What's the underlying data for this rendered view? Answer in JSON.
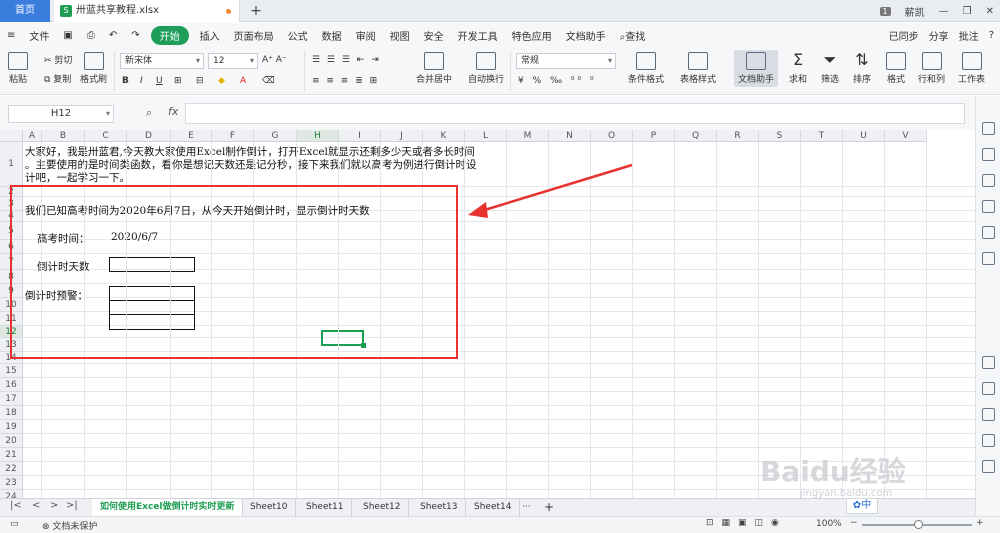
{
  "tabs": {
    "home": "首页",
    "file": "卅蓝共享教程.xlsx",
    "new": "+"
  },
  "window": {
    "badge": "1",
    "user": "薪凯"
  },
  "menu": {
    "file": "文件",
    "items": [
      "开始",
      "插入",
      "页面布局",
      "公式",
      "数据",
      "审阅",
      "视图",
      "安全",
      "开发工具",
      "特色应用",
      "文档助手"
    ],
    "search": "查找",
    "right": [
      "已同步",
      "分享",
      "批注",
      "?"
    ]
  },
  "ribbon": {
    "paste": "粘贴",
    "cut": "剪切",
    "copy": "复制",
    "format_painter": "格式刷",
    "font_name": "新宋体",
    "font_size": "12",
    "merge": "合并居中",
    "wrap": "自动换行",
    "number_format": "常规",
    "cond_format": "条件格式",
    "table_style": "表格样式",
    "doc_assist": "文档助手",
    "sum": "求和",
    "filter": "筛选",
    "sort": "排序",
    "format": "格式",
    "rowcol": "行和列",
    "worksheet": "工作表"
  },
  "formula_bar": {
    "name_box": "H12",
    "fx": "fx",
    "value": ""
  },
  "columns": [
    "A",
    "B",
    "C",
    "D",
    "E",
    "F",
    "G",
    "H",
    "I",
    "J",
    "K",
    "L",
    "M",
    "N",
    "O",
    "P",
    "Q",
    "R",
    "S",
    "T",
    "U",
    "V"
  ],
  "selected_column": "H",
  "rows": [
    "1",
    "2",
    "3",
    "4",
    "5",
    "6",
    "7",
    "8",
    "9",
    "10",
    "11",
    "12",
    "13",
    "14",
    "15",
    "16",
    "17",
    "18",
    "19",
    "20",
    "21",
    "22",
    "23",
    "24"
  ],
  "selected_row": "12",
  "cells": {
    "intro_line1": "大家好，我是卅蓝君,今天教大家使用Excel制作倒计，打开Excel就显示还剩多少天或者多长时间",
    "intro_line2": "。主要使用的是时间类函数，看你是想记天数还是记分秒，接下来我们就以高考为例进行倒计时设",
    "intro_line3": "计吧，一起学习一下。",
    "task": "我们已知高考时间为2020年6月7日，从今天开始倒计时，显示倒计时天数",
    "exam_label": "高考时间：",
    "exam_date": "2020/6/7",
    "countdown_label": "倒计时天数",
    "warning_label": "倒计时预警："
  },
  "sheets": {
    "current": "如何使用Excel做倒计时实时更新",
    "others": [
      "Sheet10",
      "Sheet11",
      "Sheet12",
      "Sheet13",
      "Sheet14"
    ],
    "more": "···",
    "add": "+"
  },
  "status": {
    "protect": "文档未保护",
    "zoom": "100%",
    "input_badge": "中"
  },
  "watermark": {
    "main": "Baidu经验",
    "sub": "jingyan.baidu.com"
  }
}
